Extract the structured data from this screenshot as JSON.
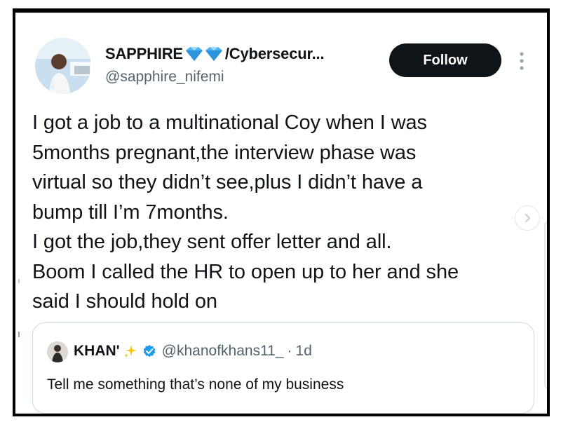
{
  "post": {
    "author": {
      "display_name_prefix": "SAPPHIRE",
      "display_name_suffix": "/Cybersecur...",
      "emoji_icon": "gem-icon",
      "handle": "@sapphire_nifemi"
    },
    "follow_label": "Follow",
    "text_lines": [
      "I got a job to a multinational Coy when I was",
      "5months pregnant,the interview phase was",
      "virtual so they didn’t see,plus I didn’t have a",
      "bump till I’m 7months.",
      "I got the job,they sent offer letter and all.",
      "Boom I called the HR to open up to her and she",
      "said I should hold on"
    ]
  },
  "quoted_post": {
    "display_name": "KHAN'",
    "emoji_icon": "sparkles-icon",
    "verified_icon": "verified-badge-icon",
    "handle": "@khanofkhans11_",
    "separator": "·",
    "time": "1d",
    "text": "Tell me something that’s none of my business"
  },
  "colors": {
    "text": "#0f1419",
    "secondary_text": "#536471",
    "follow_button_bg": "#0f1419",
    "verified_blue": "#1d9bf0",
    "gem_blue": "#4fb3f2",
    "border": "#cfd9de"
  }
}
